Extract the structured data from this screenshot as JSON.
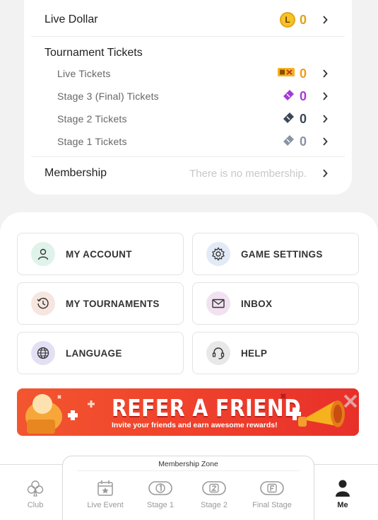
{
  "balances": {
    "live_dollar": {
      "label": "Live Dollar",
      "badge": "L",
      "value": "0"
    },
    "tournament_title": "Tournament Tickets",
    "tickets": [
      {
        "label": "Live Tickets",
        "value": "0",
        "color": "#f39a1e",
        "icon": "live-ticket-icon"
      },
      {
        "label": "Stage 3 (Final) Tickets",
        "value": "0",
        "color": "#a63ad6",
        "icon": "stage3-ticket-icon"
      },
      {
        "label": "Stage 2 Tickets",
        "value": "0",
        "color": "#3d4657",
        "icon": "stage2-ticket-icon"
      },
      {
        "label": "Stage 1 Tickets",
        "value": "0",
        "color": "#8a93a3",
        "icon": "stage1-ticket-icon"
      }
    ],
    "membership": {
      "label": "Membership",
      "value": "There is no membership."
    }
  },
  "menu": {
    "my_account": "MY ACCOUNT",
    "game_settings": "GAME SETTINGS",
    "my_tournaments": "MY TOURNAMENTS",
    "inbox": "INBOX",
    "language": "LANGUAGE",
    "help": "HELP"
  },
  "banner": {
    "title": "REFER A FRIEND",
    "subtitle": "Invite your friends and earn awesome rewards!"
  },
  "nav": {
    "zone_title": "Membership Zone",
    "items": [
      "Club",
      "Live Event",
      "Stage 1",
      "Stage 2",
      "Final Stage",
      "Me"
    ],
    "active": "Me"
  },
  "colors": {
    "live_dollar": "#e0a21a",
    "accent_orange": "#f39a1e"
  }
}
